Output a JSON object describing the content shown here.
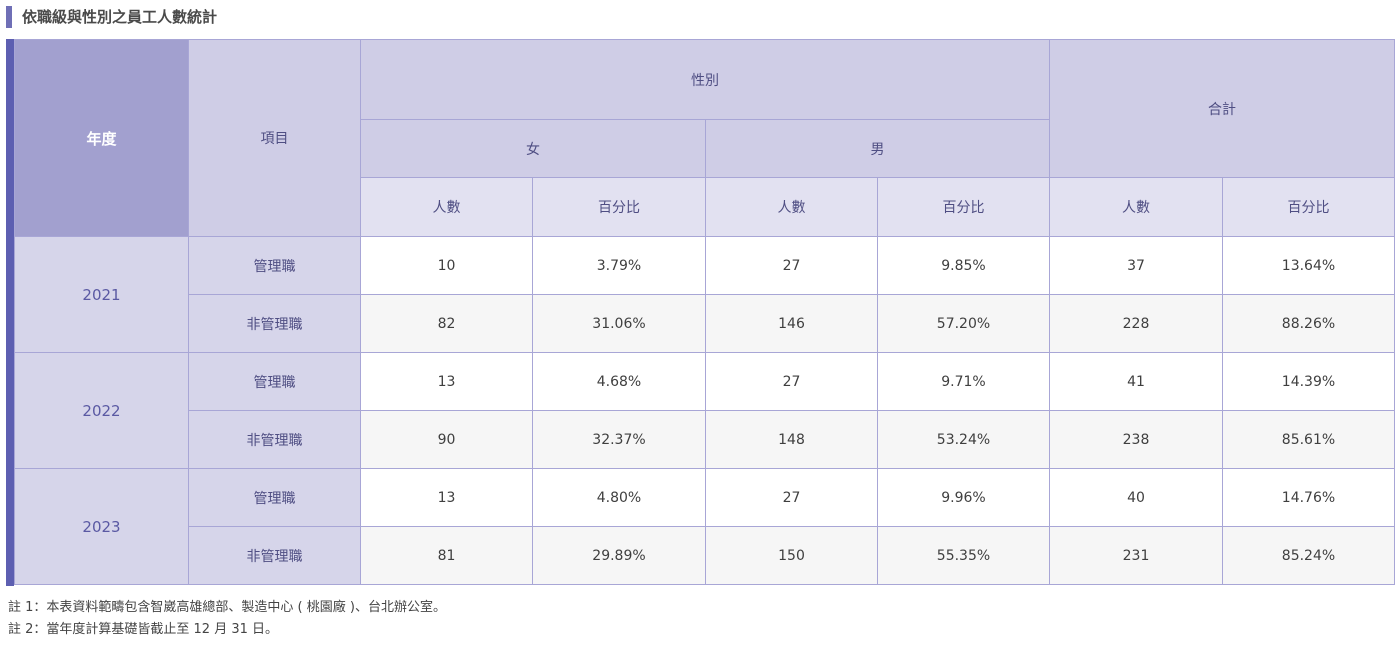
{
  "title": "依職級與性別之員工人數統計",
  "header": {
    "year": "年度",
    "item": "項目",
    "gender": "性別",
    "female": "女",
    "male": "男",
    "total": "合計",
    "count": "人數",
    "percent": "百分比"
  },
  "rows": [
    {
      "year": "2021",
      "item": "管理職",
      "f_count": "10",
      "f_pct": "3.79%",
      "m_count": "27",
      "m_pct": "9.85%",
      "t_count": "37",
      "t_pct": "13.64%"
    },
    {
      "item": "非管理職",
      "f_count": "82",
      "f_pct": "31.06%",
      "m_count": "146",
      "m_pct": "57.20%",
      "t_count": "228",
      "t_pct": "88.26%"
    },
    {
      "year": "2022",
      "item": "管理職",
      "f_count": "13",
      "f_pct": "4.68%",
      "m_count": "27",
      "m_pct": "9.71%",
      "t_count": "41",
      "t_pct": "14.39%"
    },
    {
      "item": "非管理職",
      "f_count": "90",
      "f_pct": "32.37%",
      "m_count": "148",
      "m_pct": "53.24%",
      "t_count": "238",
      "t_pct": "85.61%"
    },
    {
      "year": "2023",
      "item": "管理職",
      "f_count": "13",
      "f_pct": "4.80%",
      "m_count": "27",
      "m_pct": "9.96%",
      "t_count": "40",
      "t_pct": "14.76%"
    },
    {
      "item": "非管理職",
      "f_count": "81",
      "f_pct": "29.89%",
      "m_count": "150",
      "m_pct": "55.35%",
      "t_count": "231",
      "t_pct": "85.24%"
    }
  ],
  "notes": [
    "註 1：本表資料範疇包含智崴高雄總部、製造中心 ( 桃園廠 )、台北辦公室。",
    "註 2：當年度計算基礎皆截止至 12 月 31 日。"
  ],
  "colors": {
    "accent": "#5d5fb1",
    "header_dark": "#a2a0cf",
    "header_light": "#cfcde6",
    "row_label": "#d6d5ea"
  }
}
